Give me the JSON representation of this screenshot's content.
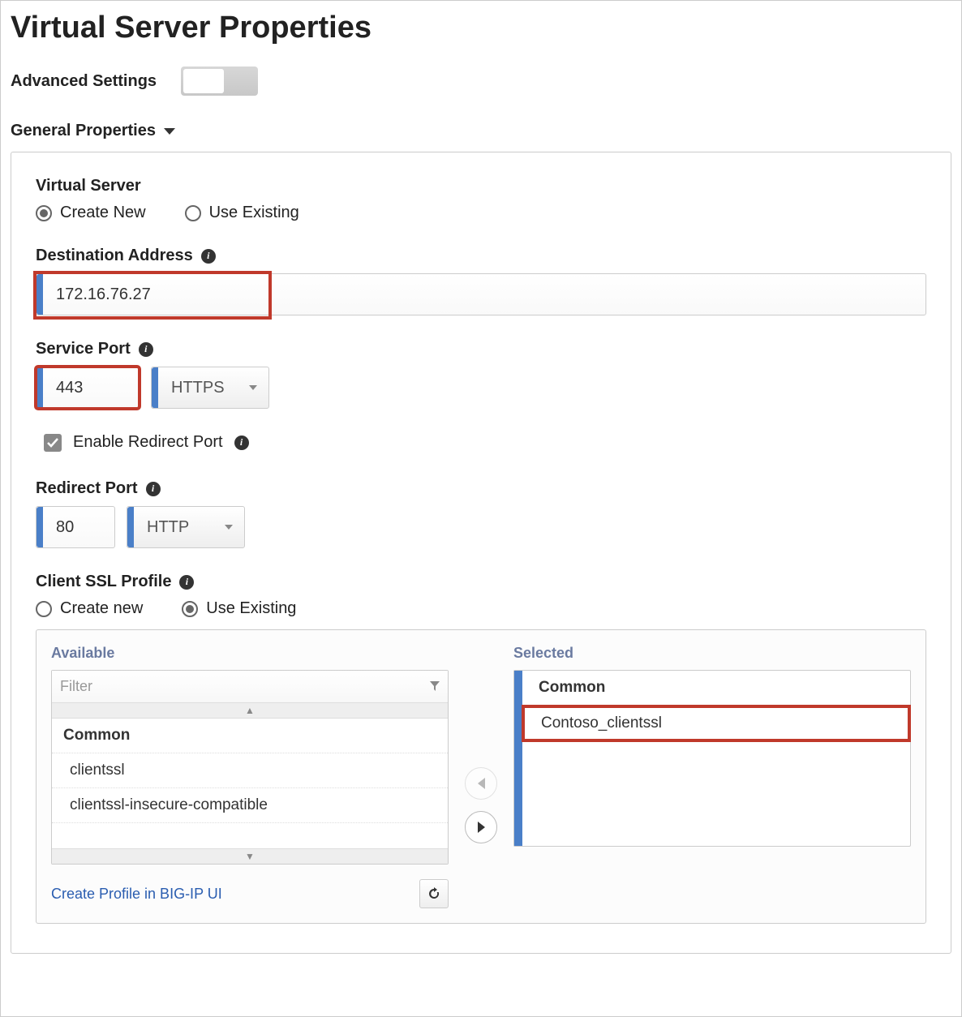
{
  "page_title": "Virtual Server Properties",
  "advanced": {
    "label": "Advanced Settings",
    "on": false
  },
  "section_general": "General Properties",
  "virtual_server": {
    "label": "Virtual Server",
    "create_new": "Create New",
    "use_existing": "Use Existing",
    "selected": "create_new"
  },
  "dest_addr": {
    "label": "Destination Address",
    "value": "172.16.76.27"
  },
  "service_port": {
    "label": "Service Port",
    "value": "443",
    "proto": "HTTPS"
  },
  "enable_redirect": {
    "label": "Enable Redirect Port",
    "checked": true
  },
  "redirect_port": {
    "label": "Redirect Port",
    "value": "80",
    "proto": "HTTP"
  },
  "ssl_profile": {
    "label": "Client SSL Profile",
    "create_new": "Create new",
    "use_existing": "Use Existing",
    "selected": "use_existing"
  },
  "picker": {
    "available": "Available",
    "selected": "Selected",
    "filter_ph": "Filter",
    "group": "Common",
    "items": [
      "clientssl",
      "clientssl-insecure-compatible"
    ],
    "sel_group": "Common",
    "sel_items": [
      "Contoso_clientssl"
    ],
    "create_link": "Create Profile in BIG-IP UI"
  }
}
